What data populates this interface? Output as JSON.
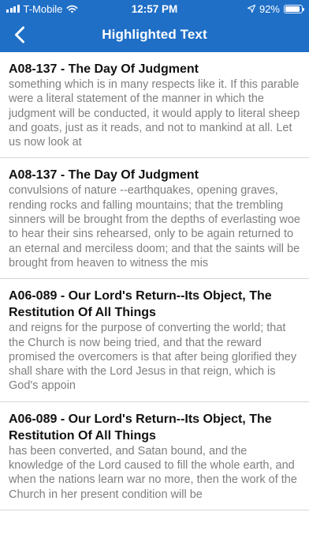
{
  "status_bar": {
    "carrier": "T-Mobile",
    "time": "12:57 PM",
    "battery_percent": "92%",
    "battery_level": 0.92,
    "icons": [
      "signal-bars-icon",
      "wifi-icon",
      "location-arrow-icon",
      "battery-icon"
    ]
  },
  "nav": {
    "title": "Highlighted Text",
    "back_icon": "chevron-left-icon"
  },
  "colors": {
    "bar": "#1f6fc7",
    "title_text": "#111111",
    "body_text": "#7f7f7f",
    "divider": "#d6d6d6"
  },
  "items": [
    {
      "title": "A08-137 - The Day Of Judgment",
      "text": "something which is in many respects like it. If this parable were a literal statement of the manner in which the judgment will be conducted, it would apply to literal sheep and goats, just as it reads, and not to mankind at all. Let us now look at"
    },
    {
      "title": "A08-137 - The Day Of Judgment",
      "text": "convulsions of nature --earthquakes, opening graves, rending rocks and falling mountains; that the trembling sinners will be brought from the depths of everlasting woe to hear their sins rehearsed, only to be again returned to an eternal and merciless doom; and that the saints will be brought from heaven to witness the mis"
    },
    {
      "title": "A06-089 - Our Lord's Return--Its Object, The Restitution Of All Things",
      "text": "and reigns for the purpose of converting the world; that the Church is now being tried, and that the reward promised the overcomers is that after being glorified they shall share with the Lord Jesus in that reign, which is God's appoin"
    },
    {
      "title": "A06-089 - Our Lord's Return--Its Object, The Restitution Of All Things",
      "text": "has been converted, and Satan bound, and the knowledge of the Lord caused to fill the whole earth, and when the nations learn war no more, then the work of the Church in her present condition will be"
    }
  ]
}
